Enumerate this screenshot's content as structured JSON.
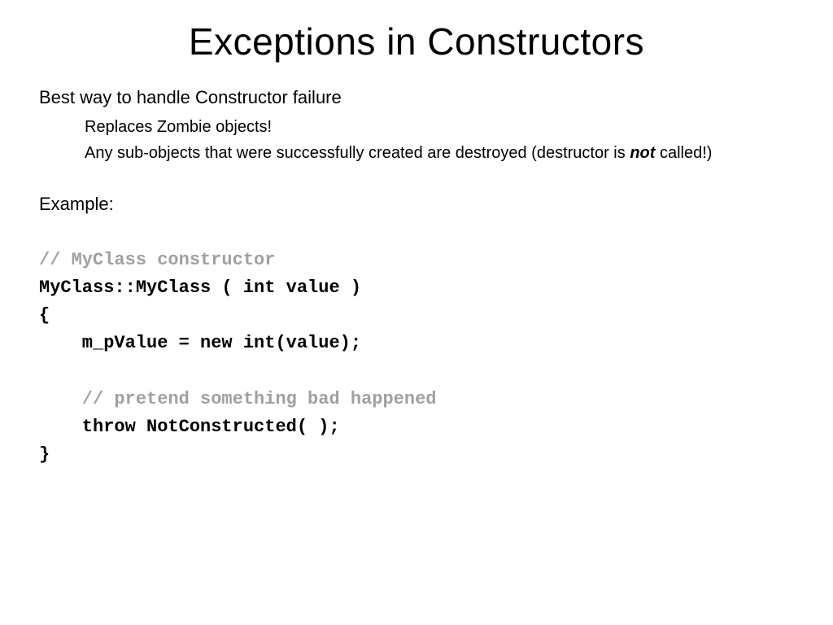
{
  "title": "Exceptions in Constructors",
  "bullets": {
    "b1": "Best way to handle Constructor failure",
    "b2": "Replaces Zombie objects!",
    "b3_pre": "Any sub-objects that were successfully created are destroyed (destructor is ",
    "b3_em": "not",
    "b3_post": " called!)",
    "example": "Example:"
  },
  "code": {
    "c1": "// MyClass constructor",
    "c2": "MyClass::MyClass ( int value )",
    "c3": "{",
    "c4": "    m_pValue = new int(value);",
    "c5": "",
    "c6": "    // pretend something bad happened",
    "c7": "    throw NotConstructed( );",
    "c8": "}"
  }
}
